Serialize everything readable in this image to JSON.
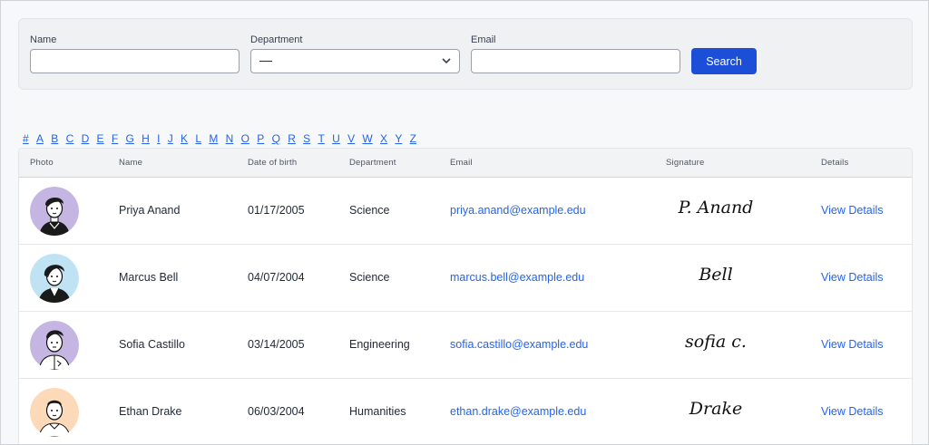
{
  "filters": {
    "name_label": "Name",
    "name_value": "",
    "department_label": "Department",
    "department_value": "—",
    "email_label": "Email",
    "email_value": "",
    "search_label": "Search"
  },
  "alphabet": [
    "#",
    "A",
    "B",
    "C",
    "D",
    "E",
    "F",
    "G",
    "H",
    "I",
    "J",
    "K",
    "L",
    "M",
    "N",
    "O",
    "P",
    "Q",
    "R",
    "S",
    "T",
    "U",
    "V",
    "W",
    "X",
    "Y",
    "Z"
  ],
  "table": {
    "headers": {
      "photo": "Photo",
      "name": "Name",
      "dob": "Date of birth",
      "department": "Department",
      "email": "Email",
      "signature": "Signature",
      "details": "Details"
    },
    "rows": [
      {
        "name": "Priya Anand",
        "dob": "01/17/2005",
        "department": "Science",
        "email": "priya.anand@example.edu",
        "signature": "P. Anand",
        "details": "View Details",
        "avatar_bg": "#c4b5e3"
      },
      {
        "name": "Marcus Bell",
        "dob": "04/07/2004",
        "department": "Science",
        "email": "marcus.bell@example.edu",
        "signature": "Bell",
        "details": "View Details",
        "avatar_bg": "#bfe3f2"
      },
      {
        "name": "Sofia Castillo",
        "dob": "03/14/2005",
        "department": "Engineering",
        "email": "sofia.castillo@example.edu",
        "signature": "sofia c.",
        "details": "View Details",
        "avatar_bg": "#c4b5e3"
      },
      {
        "name": "Ethan Drake",
        "dob": "06/03/2004",
        "department": "Humanities",
        "email": "ethan.drake@example.edu",
        "signature": "Drake",
        "details": "View Details",
        "avatar_bg": "#fcd9b8"
      }
    ]
  },
  "colors": {
    "accent": "#1d4ed8",
    "link": "#2563eb"
  }
}
